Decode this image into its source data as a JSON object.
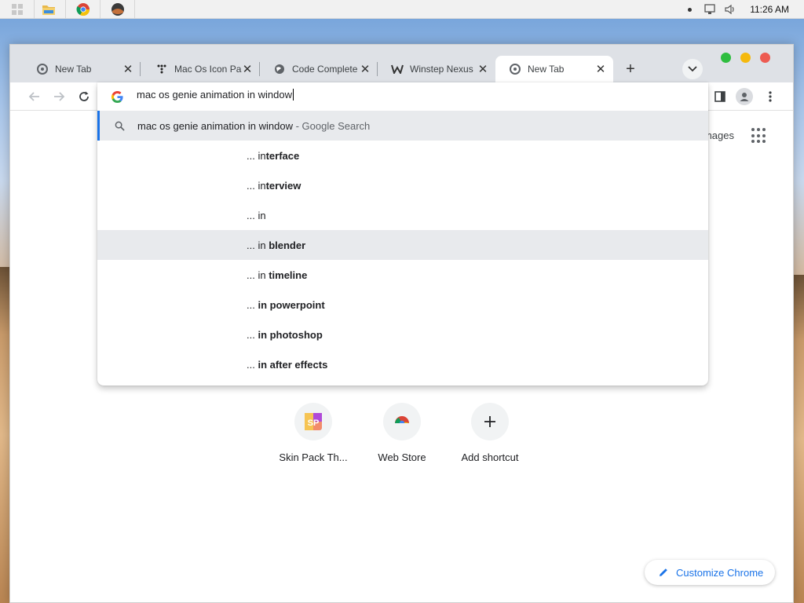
{
  "taskbar": {
    "clock": "11:26 AM",
    "buttons": [
      "windows-start-icon",
      "file-explorer-icon",
      "chrome-icon",
      "app-icon"
    ]
  },
  "tabs": [
    {
      "title": "New Tab",
      "icon": "chrome-favicon",
      "active": false
    },
    {
      "title": "Mac Os Icon Pa",
      "icon": "dots-favicon",
      "active": false
    },
    {
      "title": "Code Complete",
      "icon": "globe-favicon",
      "active": false
    },
    {
      "title": "Winstep Nexus",
      "icon": "winstep-favicon",
      "active": false
    },
    {
      "title": "New Tab",
      "icon": "chrome-favicon",
      "active": true
    }
  ],
  "window_controls": {
    "colors": [
      "#2ebd3f",
      "#f5b90e",
      "#ed5b52"
    ]
  },
  "omnibox": {
    "input_value": "mac os genie animation in window",
    "first_suggestion": {
      "query": "mac os genie animation in window",
      "suffix": " - Google Search"
    },
    "suggestions": [
      {
        "prefix": "... in",
        "bold": "terface",
        "highlighted": false
      },
      {
        "prefix": "... in",
        "bold": "terview",
        "highlighted": false
      },
      {
        "prefix": "... in",
        "bold": "",
        "highlighted": false
      },
      {
        "prefix": "... in ",
        "bold": "blender",
        "highlighted": true
      },
      {
        "prefix": "... in ",
        "bold": "timeline",
        "highlighted": false
      },
      {
        "prefix": "... ",
        "bold": "in powerpoint",
        "highlighted": false
      },
      {
        "prefix": "... ",
        "bold": "in photoshop",
        "highlighted": false
      },
      {
        "prefix": "... ",
        "bold": "in after effects",
        "highlighted": false
      }
    ]
  },
  "page": {
    "images_link": "Images",
    "shortcuts": [
      {
        "label": "Skin Pack Th...",
        "icon": "skinpack-icon"
      },
      {
        "label": "Web Store",
        "icon": "webstore-icon"
      },
      {
        "label": "Add shortcut",
        "icon": "plus-icon"
      }
    ],
    "customize_label": "Customize Chrome"
  },
  "colors": {
    "accent": "#1a73e8",
    "highlight": "#e8eaed"
  }
}
